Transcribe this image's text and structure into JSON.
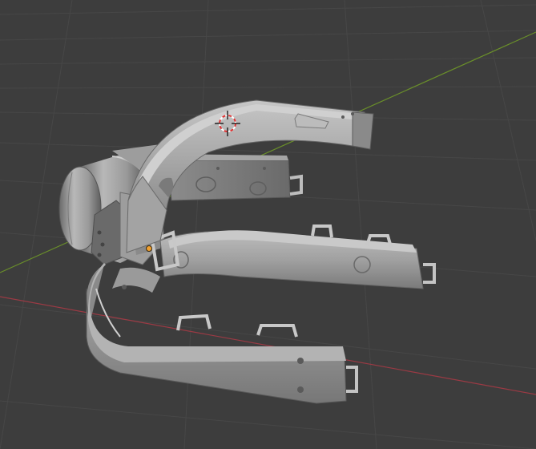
{
  "viewport": {
    "view": "3D Viewport",
    "colors": {
      "background": "#3d3d3d",
      "grid_line": "#4a4a4a",
      "x_axis": "#9b3a44",
      "y_axis": "#6a8f2a",
      "mesh_base": "#9a9a9a",
      "mesh_light": "#c2c2c2",
      "mesh_dark": "#6c6c6c",
      "origin_point": "#f0a030",
      "cursor_red": "#e03030"
    },
    "icons": [
      "3d-cursor-icon",
      "origin-point-icon"
    ]
  }
}
